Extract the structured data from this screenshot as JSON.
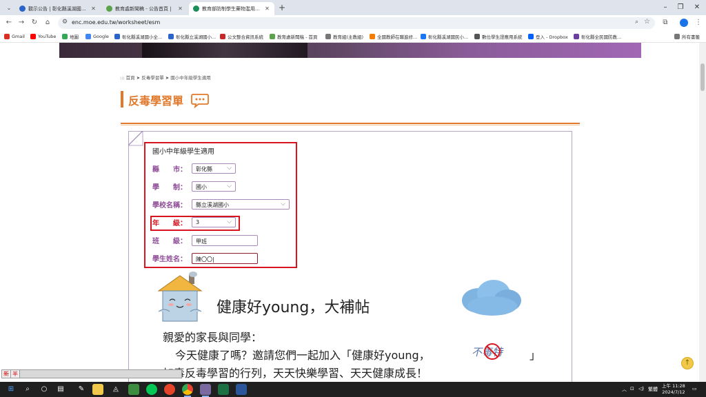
{
  "browser": {
    "tabs": [
      {
        "title": "觀示公告 | 彰化縣溪湖國小全球...",
        "color": "#2b64c8"
      },
      {
        "title": "教育處新聞稿 - 公告首頁 |",
        "color": "#5aa34b"
      },
      {
        "title": "教育部防制學生藥物濫用資源網",
        "color": "#1a8f5a"
      }
    ],
    "url": "enc.moe.edu.tw/worksheet/esm",
    "bookmarks": [
      {
        "label": "Gmail",
        "color": "#d93025"
      },
      {
        "label": "YouTube",
        "color": "#ff0000"
      },
      {
        "label": "地圖",
        "color": "#34a853"
      },
      {
        "label": "Google",
        "color": "#4285f4"
      },
      {
        "label": "彰化縣溪湖國小全...",
        "color": "#2b64c8"
      },
      {
        "label": "彰化縣立溪湖國小...",
        "color": "#2b64c8"
      },
      {
        "label": "公文整合資訊系統",
        "color": "#c62828"
      },
      {
        "label": "教育處新聞稿 - 首頁",
        "color": "#5aa34b"
      },
      {
        "label": "教育組(主教組)",
        "color": "#777777"
      },
      {
        "label": "全國教師在職進修...",
        "color": "#f57c00"
      },
      {
        "label": "彰化縣溪湖國民小...",
        "color": "#1877f2"
      },
      {
        "label": "數位學生證應用系統",
        "color": "#555555"
      },
      {
        "label": "登入 - Dropbox",
        "color": "#0061fe"
      },
      {
        "label": "彰化縣全民國防教...",
        "color": "#6a3fa0"
      },
      {
        "label": "所有書籤",
        "color": "#777777"
      }
    ]
  },
  "page": {
    "breadcrumb": "::: 首頁 ➤ 反毒學習單 ➤ 國小中年級學生適用",
    "title": "反毒學習單",
    "form": {
      "heading": "國小中年級學生適用",
      "county_label": "縣　　市：",
      "county_value": "彰化縣",
      "school_type_label": "學　　制：",
      "school_type_value": "國小",
      "school_name_label": "學校名稱：",
      "school_name_value": "縣立溪湖國小",
      "grade_label": "年　　級：",
      "grade_value": "3",
      "class_label": "班　　級：",
      "class_value": "甲班",
      "student_label": "學生姓名：",
      "student_value": "陳〇〇|"
    },
    "poster": {
      "title": "健康好young，大補帖",
      "greeting": "親愛的家長與同學：",
      "line2": "今天健康了嗎？邀請您們一起加入「健康好young，",
      "line2_end": "」",
      "line3": "加毒反毒學習的行列，天天快樂學習、天天健康成長！",
      "logo_text": "不毒特"
    },
    "ime": [
      "新",
      "半"
    ]
  },
  "taskbar": {
    "tray_text": "繁體",
    "time": "上午 11:28",
    "date": "2024/7/12"
  }
}
